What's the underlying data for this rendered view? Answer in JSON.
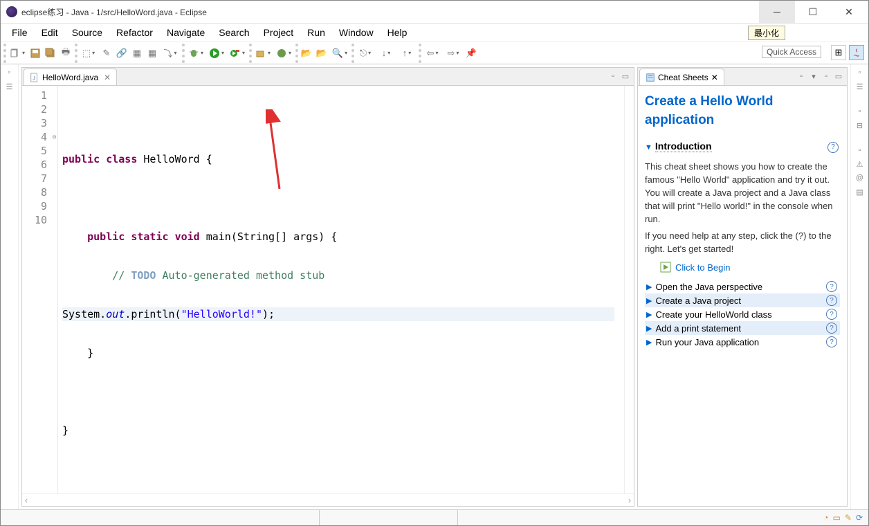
{
  "window": {
    "title": "eclipse练习 - Java - 1/src/HelloWord.java - Eclipse",
    "minimize_tooltip": "最小化",
    "quick_access": "Quick Access"
  },
  "menu": {
    "items": [
      "File",
      "Edit",
      "Source",
      "Refactor",
      "Navigate",
      "Search",
      "Project",
      "Run",
      "Window",
      "Help"
    ]
  },
  "editor": {
    "tab_label": "HelloWord.java",
    "lines": [
      "1",
      "2",
      "3",
      "4",
      "5",
      "6",
      "7",
      "8",
      "9",
      "10"
    ],
    "code": {
      "l1": "",
      "l2_tokens": [
        "public",
        " ",
        "class",
        " HelloWord {"
      ],
      "l3": "",
      "l4_tokens": [
        "    ",
        "public",
        " ",
        "static",
        " ",
        "void",
        " main(String[] args) {"
      ],
      "l5_tokens": [
        "        // ",
        "TODO",
        " Auto-generated method stub"
      ],
      "l6_tokens": [
        "System.",
        "out",
        ".println(",
        "\"HelloWorld!\"",
        ");"
      ],
      "l7": "    }",
      "l8": "",
      "l9": "}",
      "l10": ""
    }
  },
  "cheatsheet": {
    "tab_label": "Cheat Sheets",
    "title": "Create a Hello World application",
    "intro_heading": "Introduction",
    "intro_text": "This cheat sheet shows you how to create the famous \"Hello World\" application and try it out. You will create a Java project and a Java class that will print \"Hello world!\" in the console when run.",
    "help_text": "If you need help at any step, click the (?) to the right. Let's get started!",
    "begin_link": "Click to Begin",
    "steps": [
      "Open the Java perspective",
      "Create a Java project",
      "Create your HelloWorld class",
      "Add a print statement",
      "Run your Java application"
    ]
  }
}
